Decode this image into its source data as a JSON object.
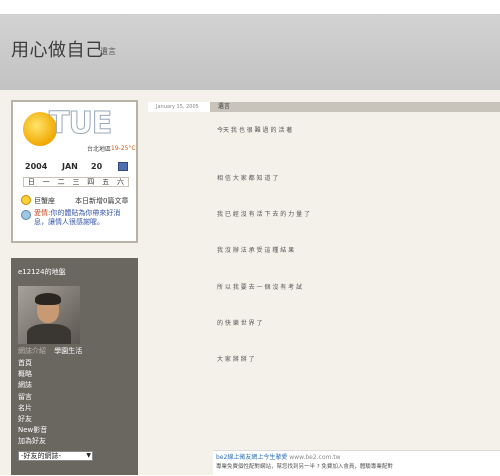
{
  "header": {
    "title": "用心做自己",
    "subtitle": "遺言"
  },
  "widget": {
    "day": "TUE",
    "city": "台北地區",
    "temp": "19-25°C",
    "year": "2004",
    "month": "JAN",
    "date": "20",
    "weekdays": [
      "日",
      "一",
      "二",
      "三",
      "四",
      "五",
      "六"
    ],
    "star_label": "巨蟹座",
    "today_label": "本日新增0篇文章",
    "tip_who": "愛情:",
    "tip_text": "你的體貼為你帶來好消息，讓情人很感謝喔。"
  },
  "profile": {
    "name": "e12124的地盤",
    "tabs": [
      "網誌介紹",
      "學園生活"
    ],
    "nav": [
      "首頁",
      "概略",
      "網誌",
      "留言",
      "名片",
      "好友",
      "New影音",
      "加為好友"
    ],
    "select_value": "-好友的網誌-"
  },
  "post": {
    "date": "January 15, 2005",
    "title": "遺言",
    "lines": [
      "今天 我 也 很 難 過 的 活 著",
      "相 信 大 家 都 知 道 了",
      "我 已 經 沒 有 活 下 去 的 力 量 了",
      "我 沒 辦 法 承 受 這 種 結 果",
      "所 以 我 要 去 一 個 沒 有 考 試",
      "的 快 樂 世 界 了",
      "大 家 掰 掰 了"
    ]
  },
  "ad": {
    "headline": "be2線上徵友網上今生摯愛",
    "url": "www.be2.com.tw",
    "text": "專業免費個性配對網站，幫您找到另一半 ? 免費加入會員，體驗專業配對"
  }
}
